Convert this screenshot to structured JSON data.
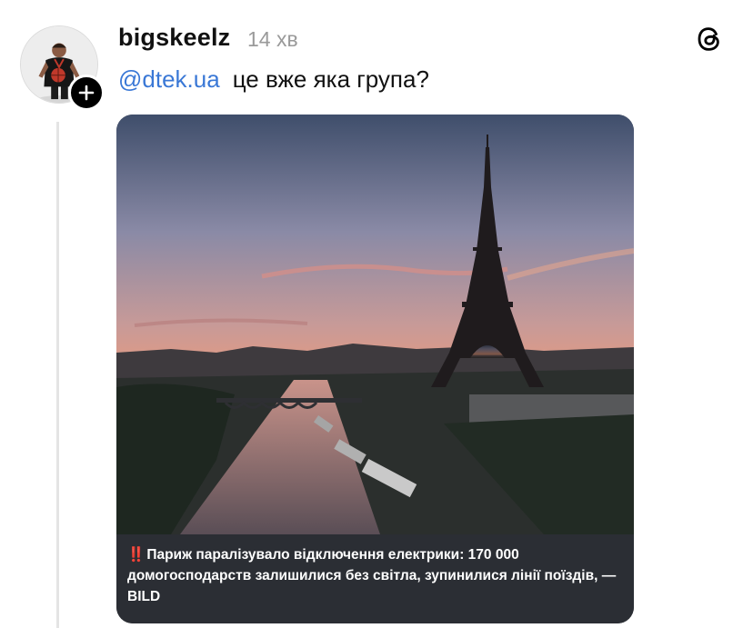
{
  "post": {
    "username": "bigskeelz",
    "timestamp": "14 хв",
    "mention": "@dtek.ua",
    "text": "це вже яка група?"
  },
  "media": {
    "alert_icon": "double-exclamation-icon",
    "alert_symbol": "‼️",
    "caption": "Париж паралізувало відключення електрики: 170 000 домогосподарств залишилися без світла, зупинилися лінії поїздів, — BILD"
  },
  "icons": {
    "logo": "threads-logo-icon",
    "follow": "plus-icon",
    "avatar": "profile-avatar"
  },
  "colors": {
    "mention": "#3a78d6",
    "timestamp": "#9a9a9a",
    "caption_bg": "#2b2e34",
    "alert": "#e0433a"
  }
}
